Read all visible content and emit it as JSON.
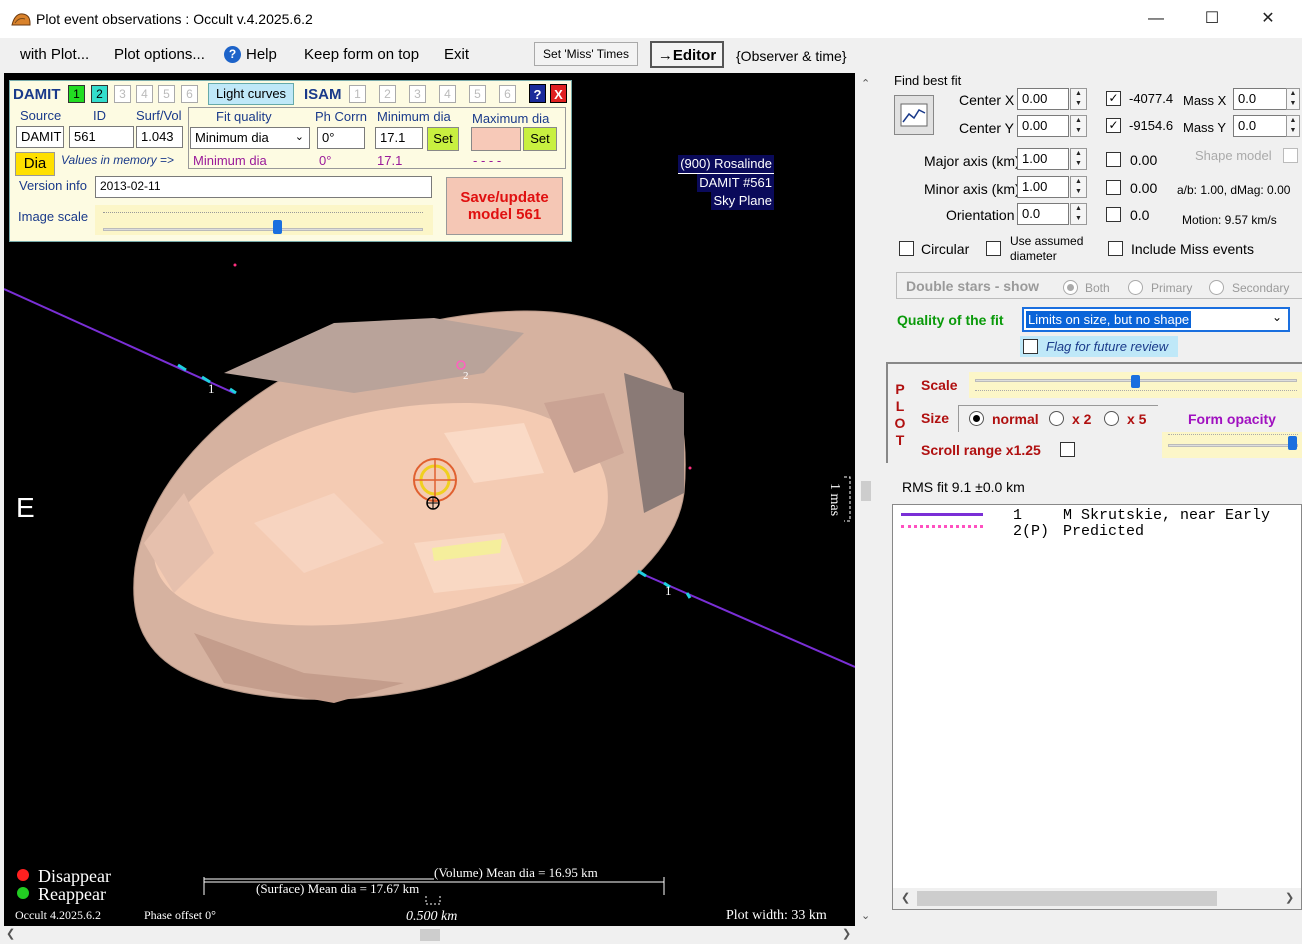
{
  "window": {
    "title": "Plot event observations : Occult v.4.2025.6.2"
  },
  "menu": {
    "with_plot": "with Plot...",
    "plot_options": "Plot options...",
    "help": "Help",
    "keep_form_on_top": "Keep form on top",
    "exit": "Exit",
    "set_miss_times": "Set 'Miss' Times",
    "editor": "→Editor",
    "observer_time": "{Observer & time}"
  },
  "damit_panel": {
    "damit_label": "DAMIT",
    "damit_nums": [
      "1",
      "2",
      "3",
      "4",
      "5",
      "6"
    ],
    "light_curves": "Light curves",
    "isam_label": "ISAM",
    "isam_nums": [
      "1",
      "2",
      "3",
      "4",
      "5",
      "6"
    ],
    "help_btn": "?",
    "close_btn": "X",
    "headers": {
      "source": "Source",
      "id": "ID",
      "surf_vol": "Surf/Vol",
      "fit_quality": "Fit quality",
      "ph_corrn": "Ph Corrn",
      "min_dia": "Minimum dia",
      "max_dia": "Maximum dia"
    },
    "source_value": "DAMIT",
    "id_value": "561",
    "surf_vol_value": "1.043",
    "fit_quality_value": "Minimum dia",
    "ph_corrn_value": "0°",
    "min_dia_value": "17.1",
    "max_dia_value": "",
    "set_label": "Set",
    "dia_btn": "Dia",
    "values_in_memory": "Values in memory =>",
    "mem_fit": "Minimum dia",
    "mem_ph": "0°",
    "mem_min": "17.1",
    "mem_max": "- - - -",
    "version_label": "Version info",
    "version_value": "2013-02-11",
    "image_scale_label": "Image scale",
    "save_update": "Save/update model 561"
  },
  "plot": {
    "info_lines": [
      "(900) Rosalinde",
      "DAMIT #561",
      "Sky Plane"
    ],
    "east_label": "E",
    "mas_label": "1 mas",
    "chord_labels": [
      "1",
      "2",
      "1"
    ],
    "legend_disappear": "Disappear",
    "legend_reappear": "Reappear",
    "version_text": "Occult 4.2025.6.2",
    "phase_offset": "Phase offset 0°",
    "volume_mean": "(Volume) Mean dia = 16.95 km",
    "surface_mean": "(Surface) Mean dia = 17.67 km",
    "scale_km": "0.500 km",
    "plot_width": "Plot width: 33 km",
    "colors": {
      "background": "#000000",
      "chord": "#7a2fd6",
      "body": "#f2c7b0",
      "disappear": "#ff2020",
      "reappear": "#22cc22"
    }
  },
  "fit": {
    "find_best_fit": "Find best fit",
    "center_x_label": "Center X",
    "center_x": "0.00",
    "center_y_label": "Center Y",
    "center_y": "0.00",
    "major_axis_label": "Major axis (km)",
    "major_axis": "1.00",
    "minor_axis_label": "Minor axis (km)",
    "minor_axis": "1.00",
    "orientation_label": "Orientation",
    "orientation": "0.0",
    "checked_x_value": "-4077.4",
    "checked_y_value": "-9154.6",
    "mass_x_label": "Mass X",
    "mass_x": "0.0",
    "mass_y_label": "Mass Y",
    "mass_y": "0.0",
    "major_fixed": "0.00",
    "minor_fixed": "0.00",
    "orient_fixed": "0.0",
    "shape_model": "Shape model",
    "ab_dmag": "a/b: 1.00, dMag: 0.00",
    "motion": "Motion: 9.57 km/s",
    "circular": "Circular",
    "use_assumed_diameter": "Use assumed diameter",
    "include_miss": "Include Miss events",
    "double_stars": "Double stars - show",
    "ds_both": "Both",
    "ds_primary": "Primary",
    "ds_secondary": "Secondary",
    "quality_label": "Quality of the fit",
    "quality_value": "Limits on size, but no shape",
    "flag_review": "Flag for future review"
  },
  "plot_settings": {
    "plot_vertical": [
      "P",
      "L",
      "O",
      "T"
    ],
    "scale_label": "Scale",
    "size_label": "Size",
    "size_normal": "normal",
    "size_x2": "x 2",
    "size_x5": "x 5",
    "form_opacity": "Form opacity",
    "scroll_range": "Scroll range x1.25"
  },
  "results": {
    "rms_fit": "RMS fit 9.1 ±0.0 km",
    "rows": [
      {
        "num": "1",
        "text": "M Skrutskie, near Early"
      },
      {
        "num": "2(P)",
        "text": "Predicted"
      }
    ]
  }
}
